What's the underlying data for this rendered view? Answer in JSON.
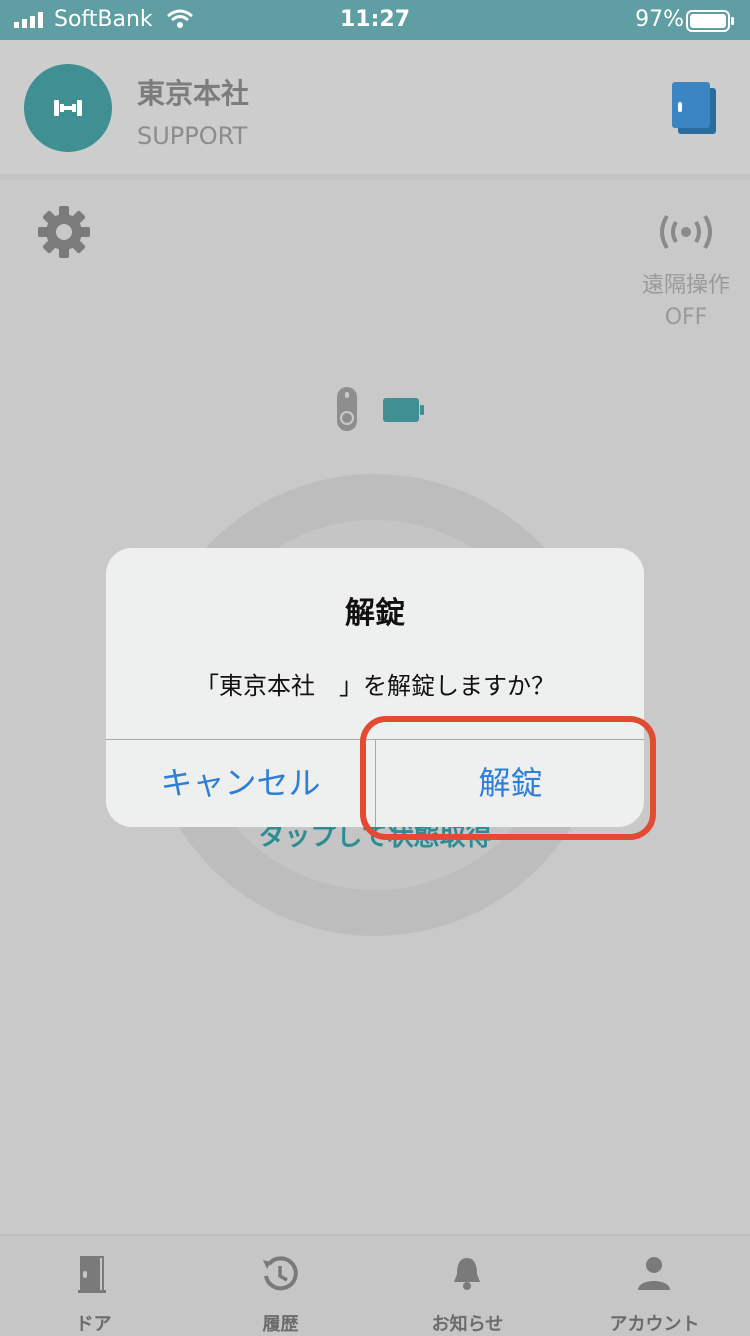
{
  "status_bar": {
    "carrier": "SoftBank",
    "time": "11:27",
    "battery_percent": "97%"
  },
  "header": {
    "site_name": "東京本社",
    "site_subtitle": "SUPPORT"
  },
  "main": {
    "remote_label_line1": "遠隔操作",
    "remote_label_line2": "OFF",
    "tap_text": "タップして状態取得"
  },
  "dialog": {
    "title": "解錠",
    "message": "「東京本社　」を解錠しますか？",
    "cancel_label": "キャンセル",
    "confirm_label": "解錠"
  },
  "tabbar": {
    "items": [
      {
        "label": "ドア",
        "icon": "door-icon"
      },
      {
        "label": "履歴",
        "icon": "history-icon"
      },
      {
        "label": "お知らせ",
        "icon": "bell-icon"
      },
      {
        "label": "アカウント",
        "icon": "person-icon"
      }
    ]
  },
  "colors": {
    "accent": "#3f8f93",
    "dialog_button": "#2f7fd7",
    "highlight": "#e24a32",
    "status_bar": "#5f9fa3"
  }
}
